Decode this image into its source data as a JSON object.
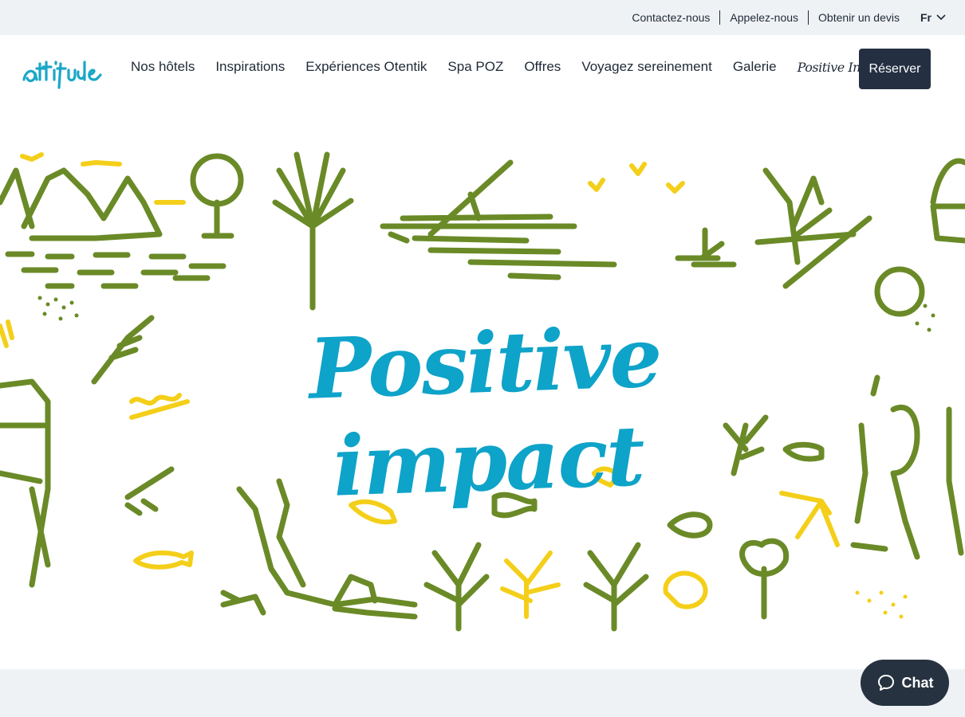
{
  "topbar": {
    "contact": "Contactez-nous",
    "call": "Appelez-nous",
    "quote": "Obtenir un devis",
    "lang": "Fr"
  },
  "brand": {
    "logo": "attitude"
  },
  "nav": {
    "items": [
      {
        "label": "Nos hôtels"
      },
      {
        "label": "Inspirations"
      },
      {
        "label": "Expériences Otentik"
      },
      {
        "label": "Spa POZ"
      },
      {
        "label": "Offres"
      },
      {
        "label": "Voyagez sereinement"
      },
      {
        "label": "Galerie"
      },
      {
        "label": "Positive Impact"
      }
    ],
    "reserve": "Réserver"
  },
  "hero": {
    "title": "Positive impact"
  },
  "chat": {
    "label": "Chat"
  },
  "colors": {
    "green": "#6a8a27",
    "yellow": "#f4cf1a",
    "teal": "#0ea3c9",
    "navy": "#243042"
  }
}
